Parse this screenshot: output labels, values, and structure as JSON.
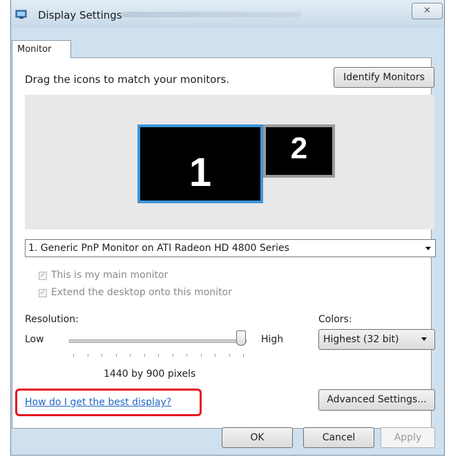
{
  "window": {
    "title": "Display Settings",
    "close_glyph": "✕"
  },
  "tabs": [
    {
      "label": "Monitor",
      "selected": true
    }
  ],
  "monitor": {
    "drag_instruction": "Drag the icons to match your monitors.",
    "identify_button": "Identify Monitors",
    "monitors": [
      {
        "label": "1",
        "selected": true
      },
      {
        "label": "2",
        "selected": false
      }
    ],
    "selected_monitor": "1. Generic PnP Monitor on ATI Radeon HD 4800 Series"
  },
  "options": {
    "main_monitor": {
      "label": "This is my main monitor",
      "checked": true,
      "enabled": false
    },
    "extend_desktop": {
      "label": "Extend the desktop onto this monitor",
      "checked": true,
      "enabled": false
    }
  },
  "resolution": {
    "label": "Resolution:",
    "low_label": "Low",
    "high_label": "High",
    "value_text": "1440 by 900 pixels",
    "slider_level": 1.0
  },
  "colors": {
    "label": "Colors:",
    "selected": "Highest (32 bit)"
  },
  "help_link": "How do I get the best display?",
  "advanced_button": "Advanced Settings...",
  "buttons": {
    "ok": "OK",
    "cancel": "Cancel",
    "apply": "Apply"
  },
  "colors_theme": {
    "selection_border": "#3e95d9",
    "highlight_box": "#e8151e",
    "link": "#2166c5"
  }
}
